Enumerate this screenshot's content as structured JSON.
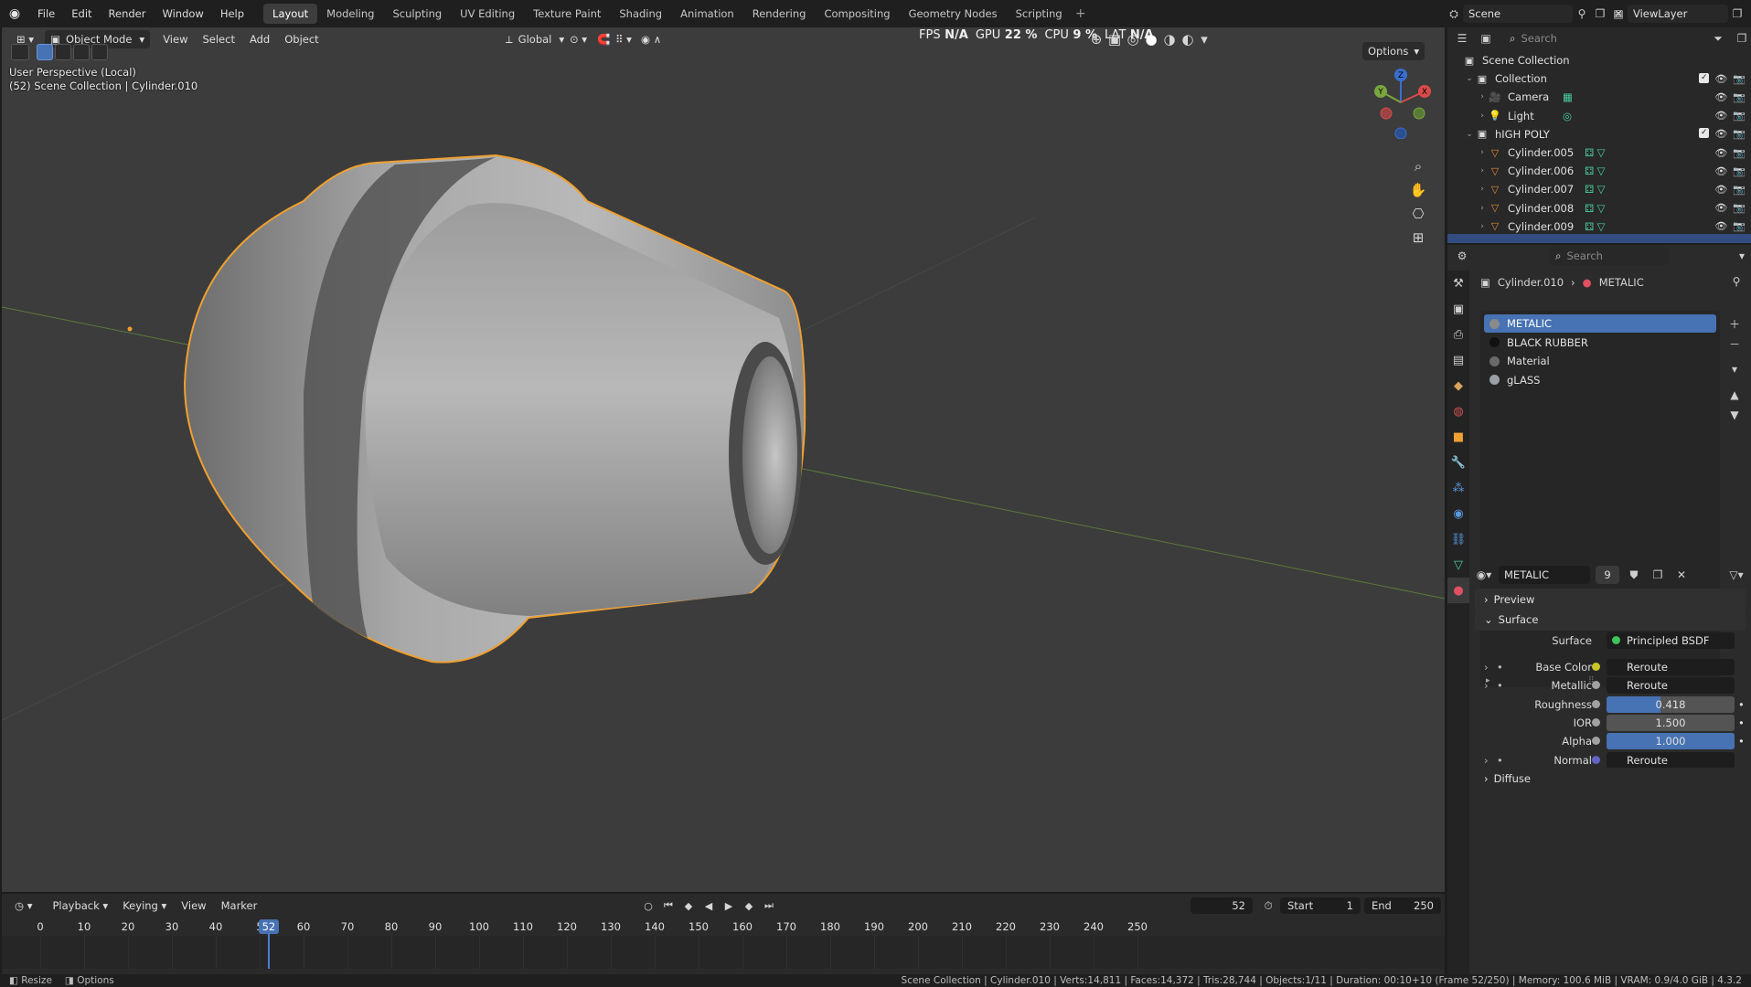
{
  "topbar": {
    "menus": [
      "File",
      "Edit",
      "Render",
      "Window",
      "Help"
    ],
    "workspaces": [
      "Layout",
      "Modeling",
      "Sculpting",
      "UV Editing",
      "Texture Paint",
      "Shading",
      "Animation",
      "Rendering",
      "Compositing",
      "Geometry Nodes",
      "Scripting"
    ],
    "active_workspace": "Layout",
    "add_symbol": "+",
    "scene_name": "Scene",
    "view_layer": "ViewLayer"
  },
  "viewport": {
    "mode": "Object Mode",
    "menus": [
      "View",
      "Select",
      "Add",
      "Object"
    ],
    "transform_orientation": "Global",
    "options_label": "Options",
    "perspective_label": "User Perspective (Local)",
    "collection_label": "(52) Scene Collection | Cylinder.010",
    "perf": {
      "fps_label": "FPS",
      "fps_value": "N/A",
      "gpu_label": "GPU",
      "gpu_value": "22 %",
      "cpu_label": "CPU",
      "cpu_value": "9 %",
      "lat_label": "LAT",
      "lat_value": "N/A"
    },
    "gizmo": {
      "x": "X",
      "y": "Y",
      "z": "Z"
    },
    "colors": {
      "background": "#3c3c3c",
      "outline": "#f0a030",
      "grid_green": "#5b7a3a"
    }
  },
  "timeline": {
    "menus": [
      "Playback",
      "Keying",
      "View",
      "Marker"
    ],
    "current_frame": "52",
    "start_label": "Start",
    "start_value": "1",
    "end_label": "End",
    "end_value": "250",
    "ticks": [
      "0",
      "10",
      "20",
      "30",
      "40",
      "5",
      "60",
      "70",
      "80",
      "90",
      "100",
      "110",
      "120",
      "130",
      "140",
      "150",
      "160",
      "170",
      "180",
      "190",
      "200",
      "210",
      "220",
      "230",
      "240",
      "250"
    ],
    "playhead": "52"
  },
  "statusbar": {
    "left_items": [
      "Resize",
      "Options"
    ],
    "stats": "Scene Collection | Cylinder.010 | Verts:14,811 | Faces:14,372 | Tris:28,744 | Objects:1/11 | Duration: 00:10+10 (Frame 52/250) | Memory: 100.6 MiB | VRAM: 0.9/4.0 GiB | 4.3.2"
  },
  "outliner": {
    "search_placeholder": "Search",
    "rows": [
      {
        "label": "Scene Collection",
        "icon": "scene-collection-icon"
      },
      {
        "label": "Collection",
        "icon": "collection-icon"
      },
      {
        "label": "Camera",
        "icon": "camera-icon"
      },
      {
        "label": "Light",
        "icon": "light-icon"
      },
      {
        "label": "hIGH POLY",
        "icon": "collection-icon"
      },
      {
        "label": "Cylinder.005",
        "icon": "mesh-icon"
      },
      {
        "label": "Cylinder.006",
        "icon": "mesh-icon"
      },
      {
        "label": "Cylinder.007",
        "icon": "mesh-icon"
      },
      {
        "label": "Cylinder.008",
        "icon": "mesh-icon"
      },
      {
        "label": "Cylinder.009",
        "icon": "mesh-icon"
      }
    ]
  },
  "properties": {
    "search_placeholder": "Search",
    "breadcrumb_object": "Cylinder.010",
    "breadcrumb_material": "METALIC",
    "materials": [
      {
        "name": "METALIC",
        "color": "#8a8a8a"
      },
      {
        "name": "BLACK RUBBER",
        "color": "#111111"
      },
      {
        "name": "Material",
        "color": "#6a6a6a"
      },
      {
        "name": "gLASS",
        "color": "#9aa0a6"
      }
    ],
    "material_field": "METALIC",
    "user_count": "9",
    "panels": {
      "preview": "Preview",
      "surface": "Surface",
      "diffuse": "Diffuse"
    },
    "surface_label": "Surface",
    "surface_value": "Principled BSDF",
    "inputs": [
      {
        "label": "Base Color",
        "value": "Reroute",
        "socket": "#c7c729"
      },
      {
        "label": "Metallic",
        "value": "Reroute",
        "socket": "#a1a1a1"
      },
      {
        "label": "Roughness",
        "value": "0.418",
        "socket": "#a1a1a1",
        "fraction": 0.418
      },
      {
        "label": "IOR",
        "value": "1.500",
        "socket": "#a1a1a1",
        "fraction": 0.0
      },
      {
        "label": "Alpha",
        "value": "1.000",
        "socket": "#a1a1a1",
        "fraction": 1.0
      },
      {
        "label": "Normal",
        "value": "Reroute",
        "socket": "#6363c7"
      }
    ]
  }
}
